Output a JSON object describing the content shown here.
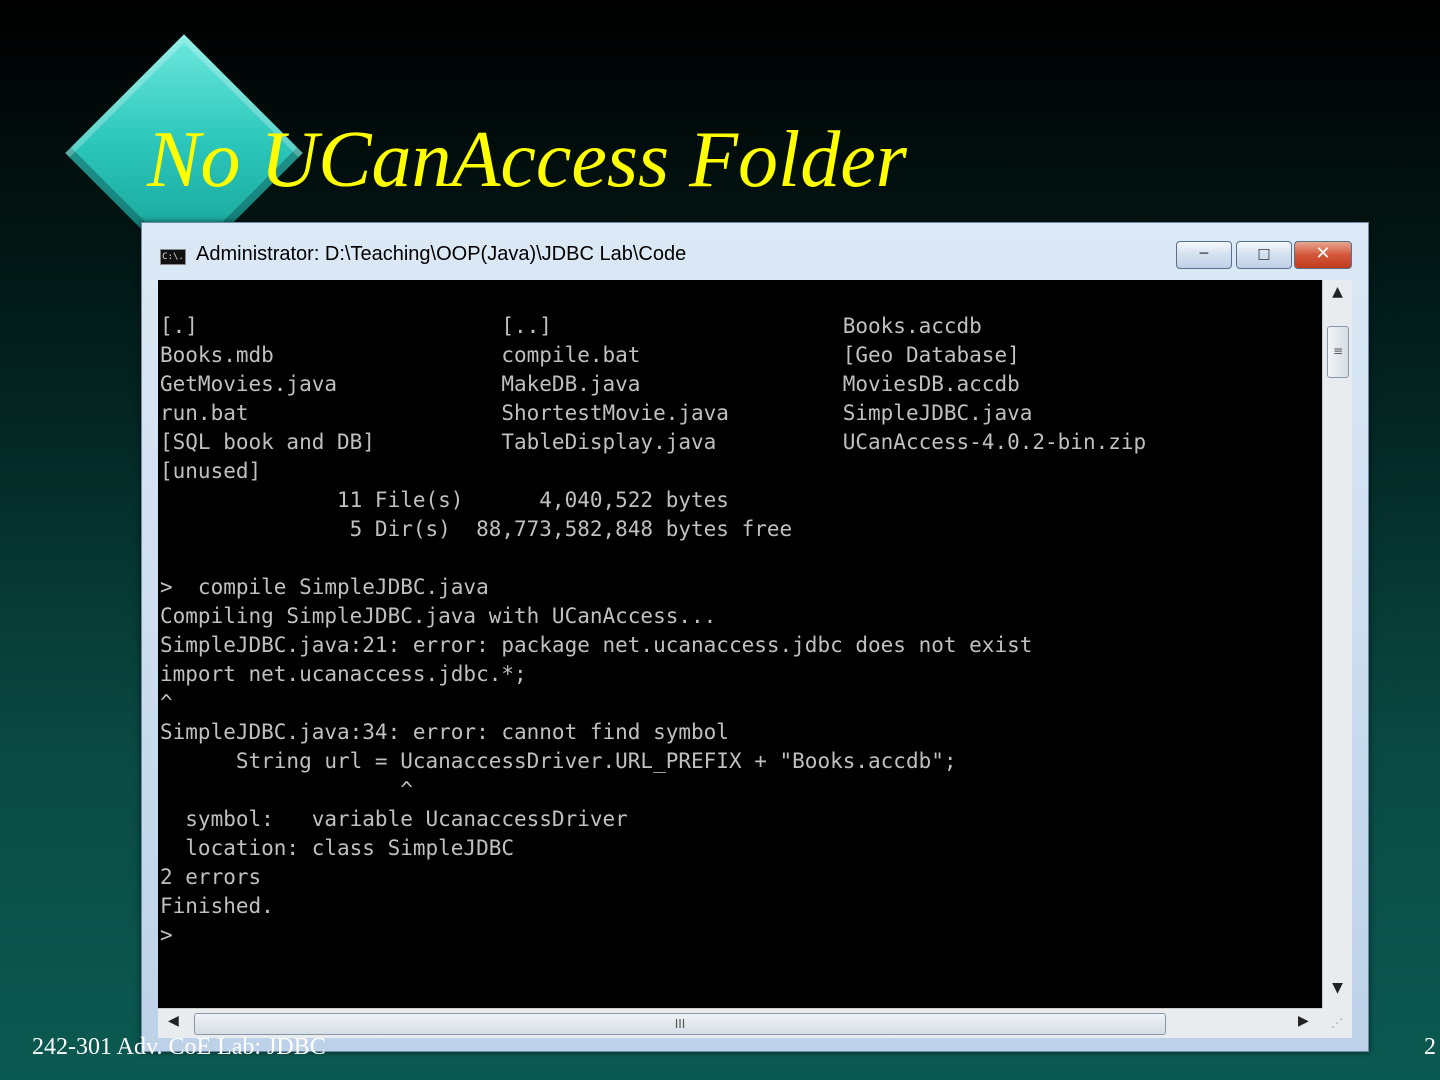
{
  "slide": {
    "title": "No UCanAccess Folder",
    "footer_left": "242-301 Adv. CoE Lab: JDBC",
    "page_number": "2"
  },
  "window": {
    "title": "Administrator:  D:\\Teaching\\OOP(Java)\\JDBC Lab\\Code",
    "icon_label": "C:\\.",
    "minimize_icon": "minimize-icon",
    "maximize_icon": "maximize-icon",
    "close_icon": "close-icon"
  },
  "console": {
    "lines": [
      "[.]                        [..]                       Books.accdb",
      "Books.mdb                  compile.bat                [Geo Database]",
      "GetMovies.java             MakeDB.java                MoviesDB.accdb",
      "run.bat                    ShortestMovie.java         SimpleJDBC.java",
      "[SQL book and DB]          TableDisplay.java          UCanAccess-4.0.2-bin.zip",
      "[unused]",
      "              11 File(s)      4,040,522 bytes",
      "               5 Dir(s)  88,773,582,848 bytes free",
      "",
      ">  compile SimpleJDBC.java",
      "Compiling SimpleJDBC.java with UCanAccess...",
      "SimpleJDBC.java:21: error: package net.ucanaccess.jdbc does not exist",
      "import net.ucanaccess.jdbc.*;",
      "^",
      "SimpleJDBC.java:34: error: cannot find symbol",
      "      String url = UcanaccessDriver.URL_PREFIX + \"Books.accdb\";",
      "                   ^",
      "  symbol:   variable UcanaccessDriver",
      "  location: class SimpleJDBC",
      "2 errors",
      "Finished.",
      ">"
    ]
  },
  "scrollbars": {
    "vertical_thumb_glyph": "≡",
    "horizontal_thumb_glyph": "III"
  }
}
